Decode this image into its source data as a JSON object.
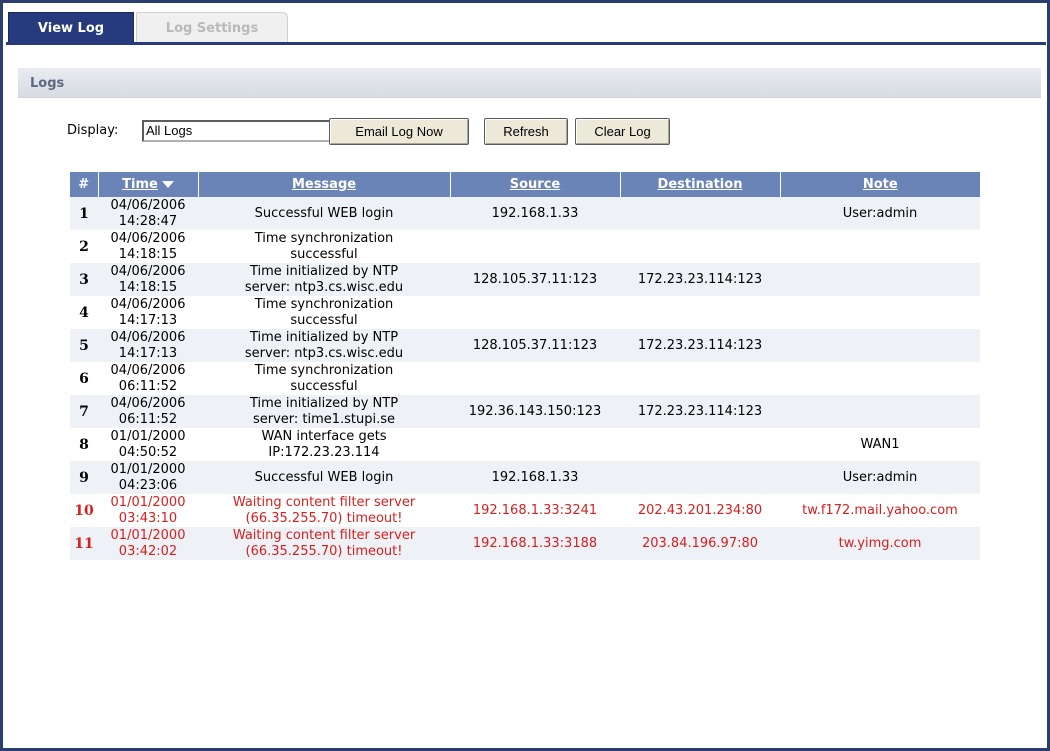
{
  "tabs": [
    {
      "label": "View Log",
      "active": true
    },
    {
      "label": "Log Settings",
      "active": false
    }
  ],
  "section": {
    "title": "Logs"
  },
  "controls": {
    "display_label": "Display:",
    "display_value": "All Logs",
    "email_button": "Email Log Now",
    "refresh_button": "Refresh",
    "clear_button": "Clear Log"
  },
  "table": {
    "columns": [
      "#",
      "Time",
      "Message",
      "Source",
      "Destination",
      "Note"
    ],
    "sorted_column": "Time",
    "rows": [
      {
        "num": "1",
        "date": "04/06/2006",
        "time": "14:28:47",
        "msg1": "Successful WEB login",
        "msg2": "",
        "source": "192.168.1.33",
        "destination": "",
        "note": "User:admin",
        "error": false
      },
      {
        "num": "2",
        "date": "04/06/2006",
        "time": "14:18:15",
        "msg1": "Time synchronization",
        "msg2": "successful",
        "source": "",
        "destination": "",
        "note": "",
        "error": false
      },
      {
        "num": "3",
        "date": "04/06/2006",
        "time": "14:18:15",
        "msg1": "Time initialized by NTP",
        "msg2": "server: ntp3.cs.wisc.edu",
        "source": "128.105.37.11:123",
        "destination": "172.23.23.114:123",
        "note": "",
        "error": false
      },
      {
        "num": "4",
        "date": "04/06/2006",
        "time": "14:17:13",
        "msg1": "Time synchronization",
        "msg2": "successful",
        "source": "",
        "destination": "",
        "note": "",
        "error": false
      },
      {
        "num": "5",
        "date": "04/06/2006",
        "time": "14:17:13",
        "msg1": "Time initialized by NTP",
        "msg2": "server: ntp3.cs.wisc.edu",
        "source": "128.105.37.11:123",
        "destination": "172.23.23.114:123",
        "note": "",
        "error": false
      },
      {
        "num": "6",
        "date": "04/06/2006",
        "time": "06:11:52",
        "msg1": "Time synchronization",
        "msg2": "successful",
        "source": "",
        "destination": "",
        "note": "",
        "error": false
      },
      {
        "num": "7",
        "date": "04/06/2006",
        "time": "06:11:52",
        "msg1": "Time initialized by NTP",
        "msg2": "server: time1.stupi.se",
        "source": "192.36.143.150:123",
        "destination": "172.23.23.114:123",
        "note": "",
        "error": false
      },
      {
        "num": "8",
        "date": "01/01/2000",
        "time": "04:50:52",
        "msg1": "WAN interface gets",
        "msg2": "IP:172.23.23.114",
        "source": "",
        "destination": "",
        "note": "WAN1",
        "error": false
      },
      {
        "num": "9",
        "date": "01/01/2000",
        "time": "04:23:06",
        "msg1": "Successful WEB login",
        "msg2": "",
        "source": "192.168.1.33",
        "destination": "",
        "note": "User:admin",
        "error": false
      },
      {
        "num": "10",
        "date": "01/01/2000",
        "time": "03:43:10",
        "msg1": "Waiting content filter server",
        "msg2": "(66.35.255.70) timeout!",
        "source": "192.168.1.33:3241",
        "destination": "202.43.201.234:80",
        "note": "tw.f172.mail.yahoo.com",
        "error": true
      },
      {
        "num": "11",
        "date": "01/01/2000",
        "time": "03:42:02",
        "msg1": "Waiting content filter server",
        "msg2": "(66.35.255.70) timeout!",
        "source": "192.168.1.33:3188",
        "destination": "203.84.196.97:80",
        "note": "tw.yimg.com",
        "error": true
      }
    ]
  },
  "colors": {
    "active_tab": "#273a7d",
    "header_row": "#6b84b8",
    "alt_row": "#eef1f6",
    "error_text": "#d61f1f"
  }
}
